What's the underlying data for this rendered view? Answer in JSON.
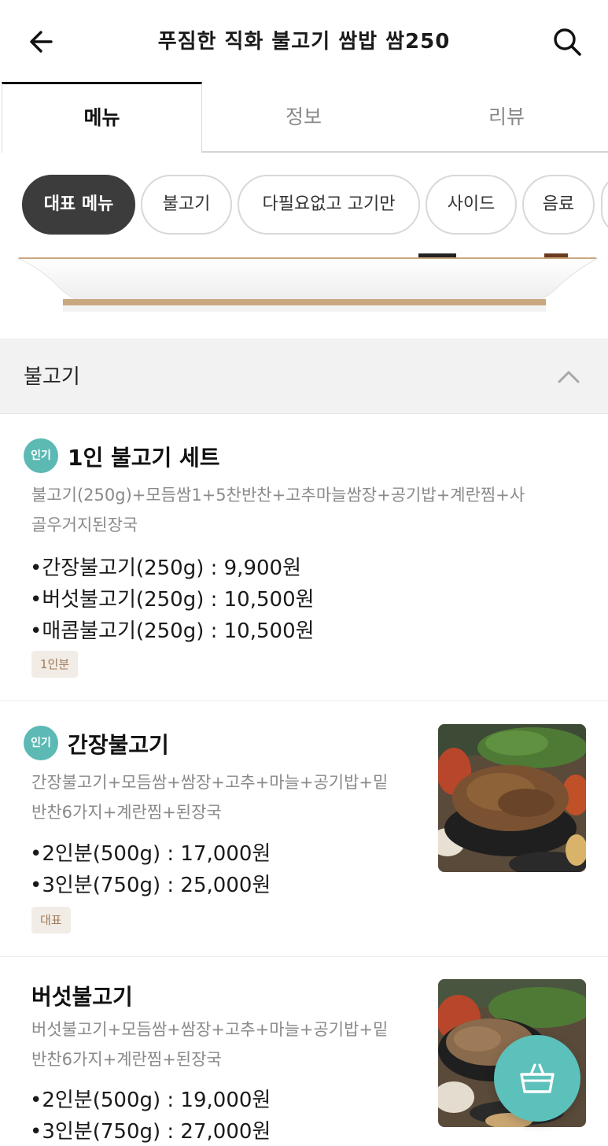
{
  "header": {
    "title": "푸짐한 직화 불고기 쌈밥 쌈250",
    "back_icon": "arrow-left-icon",
    "search_icon": "search-icon"
  },
  "tabs": [
    {
      "label": "메뉴",
      "active": true
    },
    {
      "label": "정보",
      "active": false
    },
    {
      "label": "리뷰",
      "active": false
    }
  ],
  "chips": [
    {
      "label": "대표 메뉴",
      "active": true
    },
    {
      "label": "불고기",
      "active": false
    },
    {
      "label": "다필요없고 고기만",
      "active": false
    },
    {
      "label": "사이드",
      "active": false
    },
    {
      "label": "음료",
      "active": false
    }
  ],
  "section": {
    "title": "불고기",
    "chevron_icon": "chevron-up-icon"
  },
  "items": [
    {
      "badge": "인기",
      "name": "1인 불고기 세트",
      "desc_lines": [
        "불고기(250g)+모듬쌈1+5찬반찬+고추마늘쌈장+공기밥+계란찜+사",
        "골우거지된장국"
      ],
      "prices": [
        "•간장불고기(250g) : 9,900원",
        "•버섯불고기(250g) : 10,500원",
        "•매콤불고기(250g) : 10,500원"
      ],
      "tag": "1인분"
    },
    {
      "badge": "인기",
      "name": "간장불고기",
      "desc_lines": [
        "간장불고기+모듬쌈+쌈장+고추+마늘+공기밥+밑",
        "반찬6가지+계란찜+된장국"
      ],
      "prices": [
        "•2인분(500g) : 17,000원",
        "•3인분(750g) : 25,000원"
      ],
      "tag": "대표"
    },
    {
      "name": "버섯불고기",
      "desc_lines": [
        "버섯불고기+모듬쌈+쌈장+고추+마늘+공기밥+밑",
        "반찬6가지+계란찜+된장국"
      ],
      "prices": [
        "•2인분(500g) : 19,000원",
        "•3인분(750g) : 27,000원"
      ]
    }
  ],
  "cart_icon": "basket-icon",
  "colors": {
    "accent": "#5cc0bb",
    "badge": "#5cb9b4",
    "chip_active": "#3c3c3c"
  }
}
